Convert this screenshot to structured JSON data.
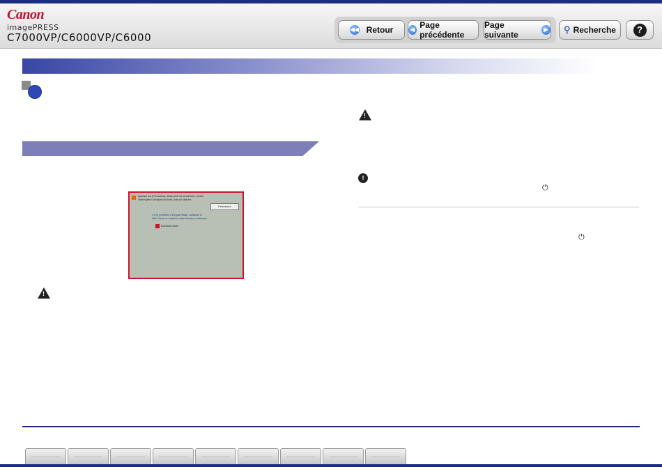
{
  "brand": {
    "logo": "Canon",
    "product_line": "imagePRESS",
    "model": "C7000VP/C6000VP/C6000",
    "brand_color": "#c8102e"
  },
  "toolbar": {
    "back_label": "Retour",
    "prev_label": "Page précédente",
    "next_label": "Page suivante",
    "search_label": "Recherche",
    "help_label": "?"
  },
  "screen": {
    "message_lines": [
      "Appuyer sur [Fermeture], darès arrêt de la machine, mettre",
      "l'interrupteur principal sur Arrêt, puis sur Marche."
    ],
    "close_button": "Fermeture",
    "bullet_lines": [
      "• Si le problème n'est pas résolu, contacter le",
      "  SAV Canon en notant le code d'erreur ci-dessous."
    ],
    "error_code": "E000000-0000"
  },
  "icons": {
    "warning": "⚠",
    "note": "!",
    "power": "⏻"
  },
  "colors": {
    "accent": "#1d2d82",
    "title_gradient_start": "#3846a5",
    "section_bar": "#7c7fb8",
    "screen_border": "#d0122c"
  },
  "footer": {
    "tab_count": 9
  }
}
